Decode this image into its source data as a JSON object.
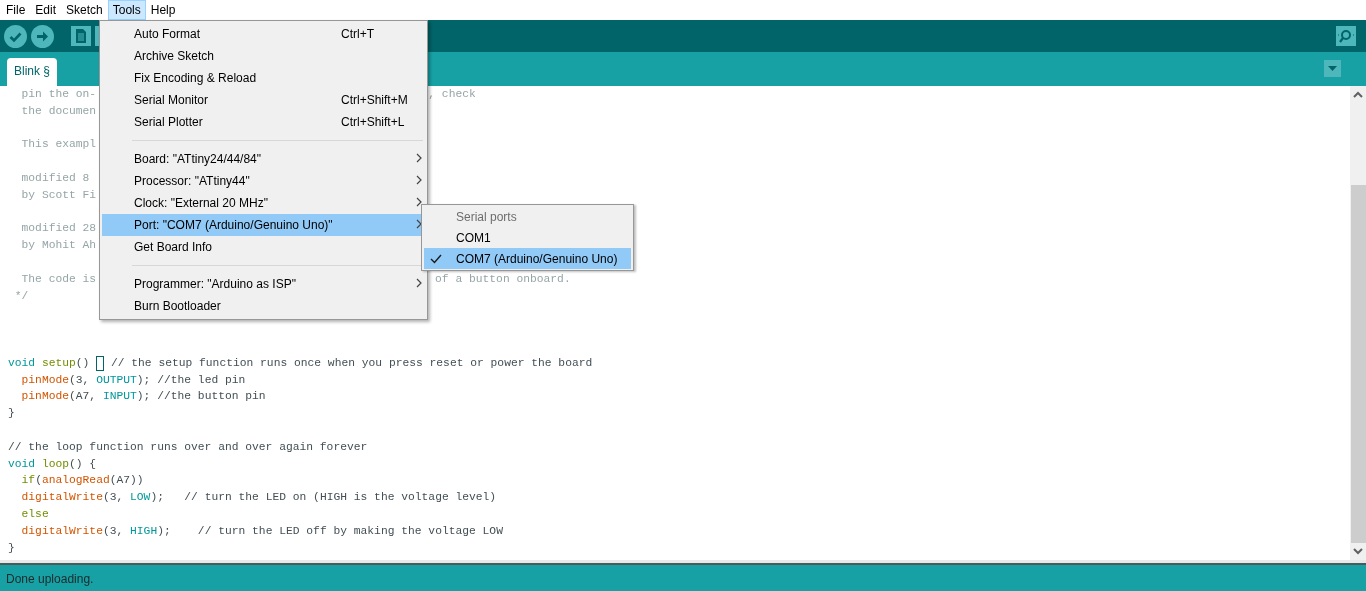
{
  "menubar": [
    {
      "label": "File",
      "selected": false
    },
    {
      "label": "Edit",
      "selected": false
    },
    {
      "label": "Sketch",
      "selected": false
    },
    {
      "label": "Tools",
      "selected": true
    },
    {
      "label": "Help",
      "selected": false
    }
  ],
  "tabs": [
    {
      "label": "Blink §",
      "selected": true
    }
  ],
  "editor": {
    "lines": [
      {
        "kind": "code",
        "tokens": [
          {
            "kind": "doc",
            "text": "  pin the on-"
          }
        ],
        "tail": ", check"
      },
      {
        "kind": "code",
        "tokens": [
          {
            "kind": "doc",
            "text": "  the documen"
          }
        ]
      },
      {
        "kind": "blank"
      },
      {
        "kind": "code",
        "tokens": [
          {
            "kind": "doc",
            "text": "  This exampl"
          }
        ]
      },
      {
        "kind": "blank"
      },
      {
        "kind": "code",
        "tokens": [
          {
            "kind": "doc",
            "text": "  modified 8"
          }
        ]
      },
      {
        "kind": "code",
        "tokens": [
          {
            "kind": "doc",
            "text": "  by Scott Fi"
          }
        ]
      },
      {
        "kind": "blank"
      },
      {
        "kind": "code",
        "tokens": [
          {
            "kind": "doc",
            "text": "  modified 28"
          }
        ]
      },
      {
        "kind": "code",
        "tokens": [
          {
            "kind": "doc",
            "text": "  by Mohit Ah"
          }
        ]
      },
      {
        "kind": "blank"
      },
      {
        "kind": "code",
        "tokens": [
          {
            "kind": "doc",
            "text": "  The code is"
          }
        ],
        "tail": " of a button onboard."
      },
      {
        "kind": "code",
        "tokens": [
          {
            "kind": "doc",
            "text": " */"
          }
        ]
      },
      {
        "kind": "blank"
      },
      {
        "kind": "blank"
      },
      {
        "kind": "blank"
      },
      {
        "kind": "code",
        "tokens": [
          {
            "kind": "type",
            "text": "void"
          },
          {
            "kind": "control",
            "text": " setup"
          },
          {
            "kind": "plain",
            "text": "() "
          },
          {
            "kind": "bracket"
          },
          {
            "kind": "comment",
            "text": " // the setup function runs once when you press reset or power the board"
          }
        ]
      },
      {
        "kind": "code",
        "tokens": [
          {
            "kind": "function",
            "text": "  pinMode"
          },
          {
            "kind": "plain",
            "text": "(3, "
          },
          {
            "kind": "constant",
            "text": "OUTPUT"
          },
          {
            "kind": "plain",
            "text": "); "
          },
          {
            "kind": "comment",
            "text": "//the led pin"
          }
        ]
      },
      {
        "kind": "code",
        "tokens": [
          {
            "kind": "function",
            "text": "  pinMode"
          },
          {
            "kind": "plain",
            "text": "(A7, "
          },
          {
            "kind": "constant",
            "text": "INPUT"
          },
          {
            "kind": "plain",
            "text": "); "
          },
          {
            "kind": "comment",
            "text": "//the button pin"
          }
        ]
      },
      {
        "kind": "code",
        "tokens": [
          {
            "kind": "plain",
            "text": "}"
          }
        ]
      },
      {
        "kind": "blank"
      },
      {
        "kind": "code",
        "tokens": [
          {
            "kind": "comment",
            "text": "// the loop function runs over and over again forever"
          }
        ]
      },
      {
        "kind": "code",
        "tokens": [
          {
            "kind": "type",
            "text": "void"
          },
          {
            "kind": "control",
            "text": " loop"
          },
          {
            "kind": "plain",
            "text": "() {"
          }
        ]
      },
      {
        "kind": "code",
        "tokens": [
          {
            "kind": "control",
            "text": "  if"
          },
          {
            "kind": "plain",
            "text": "("
          },
          {
            "kind": "function",
            "text": "analogRead"
          },
          {
            "kind": "plain",
            "text": "(A7))"
          }
        ]
      },
      {
        "kind": "code",
        "tokens": [
          {
            "kind": "function",
            "text": "  digitalWrite"
          },
          {
            "kind": "plain",
            "text": "(3, "
          },
          {
            "kind": "constant",
            "text": "LOW"
          },
          {
            "kind": "plain",
            "text": ");   "
          },
          {
            "kind": "comment",
            "text": "// turn the LED on (HIGH is the voltage level)"
          }
        ]
      },
      {
        "kind": "code",
        "tokens": [
          {
            "kind": "control",
            "text": "  else"
          }
        ]
      },
      {
        "kind": "code",
        "tokens": [
          {
            "kind": "function",
            "text": "  digitalWrite"
          },
          {
            "kind": "plain",
            "text": "(3, "
          },
          {
            "kind": "constant",
            "text": "HIGH"
          },
          {
            "kind": "plain",
            "text": ");    "
          },
          {
            "kind": "comment",
            "text": "// turn the LED off by making the voltage LOW"
          }
        ]
      },
      {
        "kind": "code",
        "tokens": [
          {
            "kind": "plain",
            "text": "}"
          }
        ]
      }
    ]
  },
  "menu": {
    "items": [
      {
        "kind": "item",
        "label": "Auto Format",
        "shortcut": "Ctrl+T",
        "submenu": false,
        "selected": false
      },
      {
        "kind": "item",
        "label": "Archive Sketch",
        "submenu": false,
        "selected": false
      },
      {
        "kind": "item",
        "label": "Fix Encoding & Reload",
        "submenu": false,
        "selected": false
      },
      {
        "kind": "item",
        "label": "Serial Monitor",
        "shortcut": "Ctrl+Shift+M",
        "submenu": false,
        "selected": false
      },
      {
        "kind": "item",
        "label": "Serial Plotter",
        "shortcut": "Ctrl+Shift+L",
        "submenu": false,
        "selected": false
      },
      {
        "kind": "separator"
      },
      {
        "kind": "item",
        "label": "Board: \"ATtiny24/44/84\"",
        "submenu": true,
        "selected": false
      },
      {
        "kind": "item",
        "label": "Processor: \"ATtiny44\"",
        "submenu": true,
        "selected": false
      },
      {
        "kind": "item",
        "label": "Clock: \"External 20 MHz\"",
        "submenu": true,
        "selected": false
      },
      {
        "kind": "item",
        "label": "Port: \"COM7 (Arduino/Genuino Uno)\"",
        "submenu": true,
        "selected": true
      },
      {
        "kind": "item",
        "label": "Get Board Info",
        "submenu": false,
        "selected": false
      },
      {
        "kind": "separator"
      },
      {
        "kind": "item",
        "label": "Programmer: \"Arduino as ISP\"",
        "submenu": true,
        "selected": false
      },
      {
        "kind": "item",
        "label": "Burn Bootloader",
        "submenu": false,
        "selected": false
      }
    ]
  },
  "submenu": {
    "header": "Serial ports",
    "items": [
      {
        "label": "COM1",
        "checked": false,
        "selected": false
      },
      {
        "label": "COM7 (Arduino/Genuino Uno)",
        "checked": true,
        "selected": true
      }
    ]
  },
  "status_bar": "Done uploading."
}
